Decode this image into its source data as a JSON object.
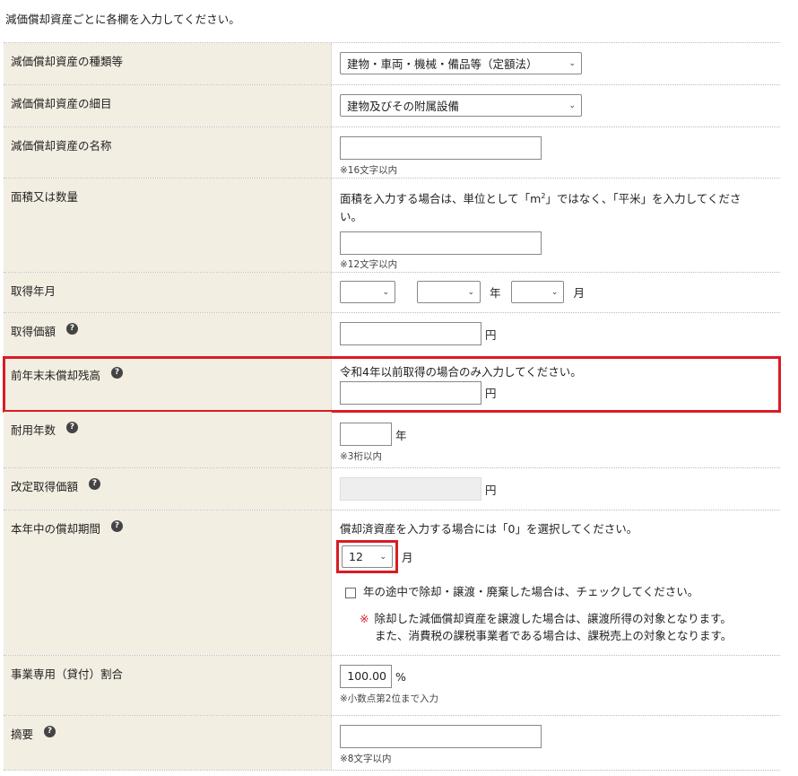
{
  "intro": "減価償却資産ごとに各欄を入力してください。",
  "asset_type": {
    "label": "減価償却資産の種類等",
    "value": "建物・車両・機械・備品等（定額法）"
  },
  "asset_detail": {
    "label": "減価償却資産の細目",
    "value": "建物及びその附属設備"
  },
  "asset_name": {
    "label": "減価償却資産の名称",
    "value": "",
    "note": "※16文字以内"
  },
  "area": {
    "label": "面積又は数量",
    "instruction_a": "面積を入力する場合は、単位として「m",
    "sup": "2",
    "instruction_b": "」ではなく、「平米」を入力してくださ",
    "instruction_c": "い。",
    "value": "",
    "note": "※12文字以内"
  },
  "acquired": {
    "label": "取得年月",
    "era": "",
    "year": "",
    "year_unit": "年",
    "month": "",
    "month_unit": "月"
  },
  "acq_price": {
    "label": "取得価額",
    "value": "",
    "unit": "円"
  },
  "prev_balance": {
    "label": "前年末未償却残高",
    "instruction": "令和4年以前取得の場合のみ入力してください。",
    "value": "",
    "unit": "円"
  },
  "useful_life": {
    "label": "耐用年数",
    "value": "",
    "unit": "年",
    "note": "※3桁以内"
  },
  "revised_price": {
    "label": "改定取得価額",
    "value": "",
    "unit": "円"
  },
  "period": {
    "label": "本年中の償却期間",
    "instruction": "償却済資産を入力する場合には「0」を選択してください。",
    "value": "12",
    "unit": "月",
    "checkbox_label": "年の途中で除却・譲渡・廃棄した場合は、チェックしてください。",
    "note_mark": "※",
    "note1": "除却した減価償却資産を譲渡した場合は、譲渡所得の対象となります。",
    "note2": "また、消費税の課税事業者である場合は、課税売上の対象となります。"
  },
  "business_ratio": {
    "label": "事業専用（貸付）割合",
    "value": "100.00",
    "unit": "%",
    "note": "※小数点第2位まで入力"
  },
  "summary": {
    "label": "摘要",
    "value": "",
    "note": "※8文字以内"
  },
  "help_glyph": "?",
  "chevron": "⌄",
  "colors": {
    "highlight": "#d91c24",
    "label_bg": "#f3eee2"
  }
}
